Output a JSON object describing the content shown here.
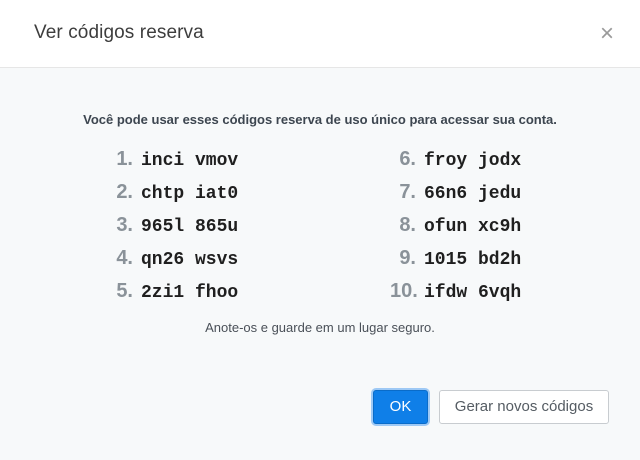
{
  "dialog": {
    "title": "Ver códigos reserva",
    "close_symbol": "×",
    "intro": "Você pode usar esses códigos reserva de uso único para acessar sua conta.",
    "codes": [
      {
        "num": "1.",
        "code": "inci vmov"
      },
      {
        "num": "2.",
        "code": "chtp iat0"
      },
      {
        "num": "3.",
        "code": "965l 865u"
      },
      {
        "num": "4.",
        "code": "qn26 wsvs"
      },
      {
        "num": "5.",
        "code": "2zi1 fhoo"
      },
      {
        "num": "6.",
        "code": "froy jodx"
      },
      {
        "num": "7.",
        "code": "66n6 jedu"
      },
      {
        "num": "8.",
        "code": "ofun xc9h"
      },
      {
        "num": "9.",
        "code": "1015 bd2h"
      },
      {
        "num": "10.",
        "code": "ifdw 6vqh"
      }
    ],
    "note": "Anote-os e guarde em um lugar seguro.",
    "ok_label": "OK",
    "regenerate_label": "Gerar novos códigos"
  },
  "colors": {
    "primary": "#0f7fe8",
    "body_bg": "#f7f9fa"
  }
}
